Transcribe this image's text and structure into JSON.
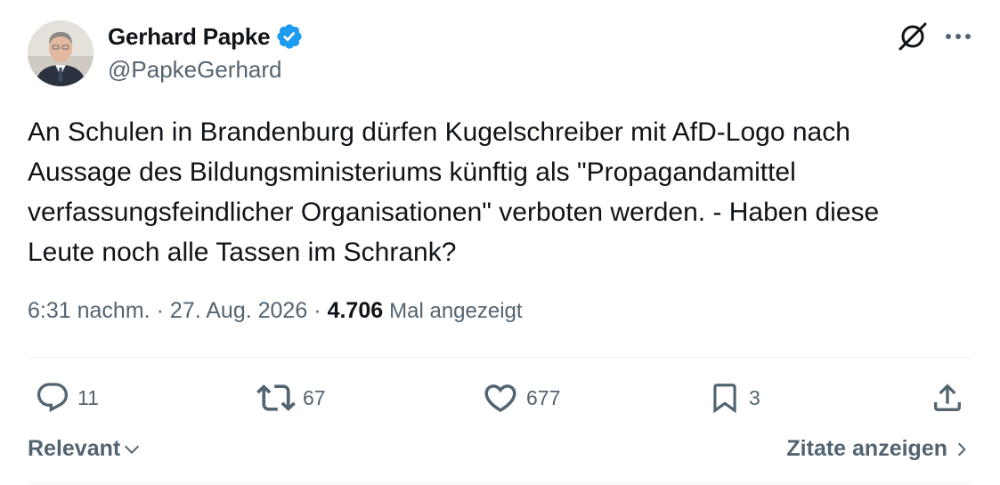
{
  "author": {
    "display_name": "Gerhard Papke",
    "handle": "@PapkeGerhard",
    "verified": true
  },
  "tweet": {
    "text": "An Schulen in Brandenburg dürfen Kugelschreiber mit AfD-Logo nach\nAussage des Bildungsministeriums künftig als \"Propagandamittel\nverfassungsfeindlicher Organisationen\" verboten werden. - Haben diese\nLeute noch alle Tassen im Schrank?",
    "time": "6:31 nachm.",
    "separator": "·",
    "date": "27. Aug. 2026",
    "views_count": "4.706",
    "views_label": "Mal angezeigt"
  },
  "actions": {
    "replies": "11",
    "reposts": "67",
    "likes": "677",
    "bookmarks": "3"
  },
  "footer": {
    "sort_label": "Relevant",
    "quotes_label": "Zitate anzeigen"
  },
  "icons": {
    "verified": "verified-badge-icon",
    "grok": "grok-icon",
    "more": "more-icon",
    "reply": "reply-icon",
    "repost": "repost-icon",
    "like": "like-icon",
    "bookmark": "bookmark-icon",
    "share": "share-icon",
    "chevron_down": "chevron-down-icon",
    "chevron_right": "chevron-right-icon"
  },
  "colors": {
    "verified_blue": "#1d9bf0",
    "text_primary": "#0f1419",
    "text_secondary": "#536471",
    "divider": "#eff3f4"
  }
}
